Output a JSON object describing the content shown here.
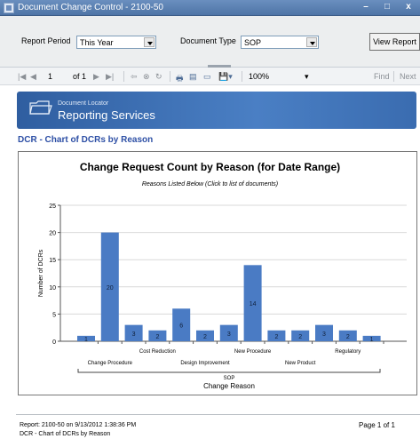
{
  "window": {
    "title": "Document Change Control - 2100-50",
    "minimize": "–",
    "maximize": "□",
    "close": "x"
  },
  "params": {
    "report_period_label": "Report Period",
    "report_period_value": "This Year",
    "document_type_label": "Document Type",
    "document_type_value": "SOP",
    "view_report": "View Report"
  },
  "toolbar": {
    "first": "|◀",
    "prev": "◀",
    "page": "1",
    "of": "of 1",
    "next": "▶",
    "last": "▶|",
    "back": "⇦",
    "stop": "⊗",
    "refresh": "↻",
    "print": "🖶",
    "layout": "▤",
    "setup": "▭",
    "export": "💾▾",
    "zoom": "100%",
    "zoom_arrow": "▾",
    "find": "Find",
    "next_find": "Next"
  },
  "banner": {
    "sub": "Document Locator",
    "main": "Reporting Services"
  },
  "report": {
    "heading": "DCR - Chart of DCRs by Reason"
  },
  "chart_data": {
    "type": "bar",
    "title": "Change Request Count by Reason  (for Date Range)",
    "subtitle": "Reasons Listed Below (Click to list of documents)",
    "ylabel": "Number of DCRs",
    "xlabel": "Change Reason",
    "group_label": "SOP",
    "ylim": [
      0,
      25
    ],
    "yticks": [
      0,
      5,
      10,
      15,
      20,
      25
    ],
    "values": [
      1,
      20,
      3,
      2,
      6,
      2,
      3,
      14,
      2,
      2,
      3,
      2,
      1
    ],
    "bar_labels": [
      "1",
      "20",
      "3",
      "2",
      "6",
      "2",
      "3",
      "14",
      "2",
      "2",
      "3",
      "2",
      "1"
    ],
    "category_labels": [
      {
        "text": "Change Procedure",
        "after_bar": 1,
        "row": 2
      },
      {
        "text": "Cost Reduction",
        "after_bar": 3,
        "row": 1
      },
      {
        "text": "Design Improvement",
        "after_bar": 5,
        "row": 2
      },
      {
        "text": "New Procedure",
        "after_bar": 7,
        "row": 1
      },
      {
        "text": "New Product",
        "after_bar": 9,
        "row": 2
      },
      {
        "text": "Regulatory",
        "after_bar": 11,
        "row": 1
      }
    ],
    "bar_color": "#4a7bc4",
    "grid": true
  },
  "footer": {
    "line1": "Report: 2100-50 on 9/13/2012 1:38:36 PM",
    "line2": "DCR - Chart of DCRs by Reason",
    "page": "Page 1 of 1"
  }
}
